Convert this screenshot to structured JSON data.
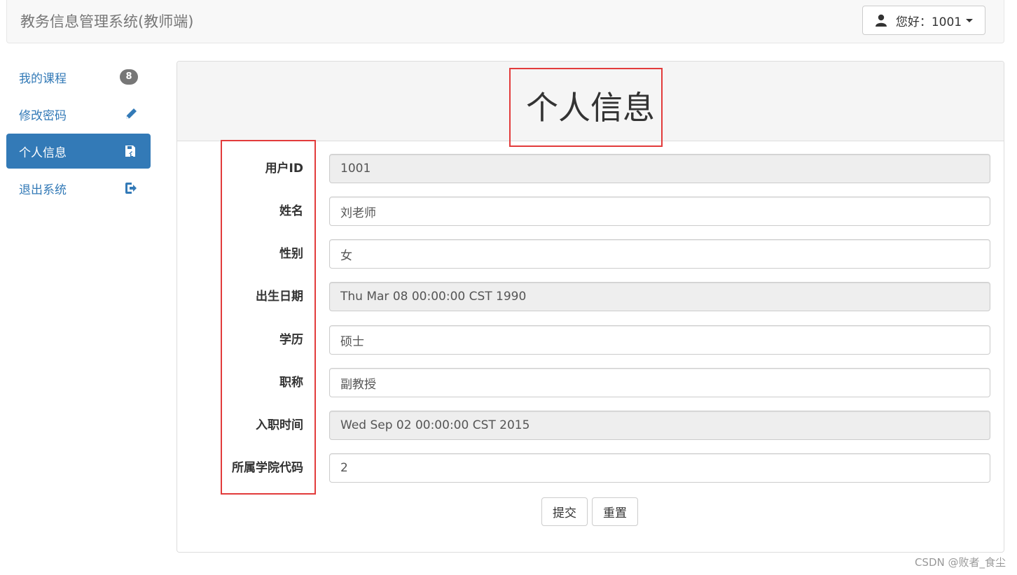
{
  "header": {
    "brand": "教务信息管理系统(教师端)",
    "user_greeting": "您好：1001"
  },
  "sidebar": {
    "items": [
      {
        "label": "我的课程",
        "badge": "8",
        "icon": "list-badge",
        "active": false
      },
      {
        "label": "修改密码",
        "icon": "pencil-icon",
        "active": false
      },
      {
        "label": "个人信息",
        "icon": "save-icon",
        "active": true
      },
      {
        "label": "退出系统",
        "icon": "logout-icon",
        "active": false
      }
    ]
  },
  "panel": {
    "title": "个人信息",
    "fields": [
      {
        "label": "用户ID",
        "value": "1001",
        "readonly": true
      },
      {
        "label": "姓名",
        "value": "刘老师",
        "readonly": false
      },
      {
        "label": "性别",
        "value": "女",
        "readonly": false
      },
      {
        "label": "出生日期",
        "value": "Thu Mar 08 00:00:00 CST 1990",
        "readonly": true
      },
      {
        "label": "学历",
        "value": "硕士",
        "readonly": false
      },
      {
        "label": "职称",
        "value": "副教授",
        "readonly": false
      },
      {
        "label": "入职时间",
        "value": "Wed Sep 02 00:00:00 CST 2015",
        "readonly": true
      },
      {
        "label": "所属学院代码",
        "value": "2",
        "readonly": false
      }
    ],
    "submit_label": "提交",
    "reset_label": "重置"
  },
  "watermark": "CSDN @败者_食尘",
  "colors": {
    "accent": "#337ab7",
    "highlight": "#e23b3b"
  }
}
